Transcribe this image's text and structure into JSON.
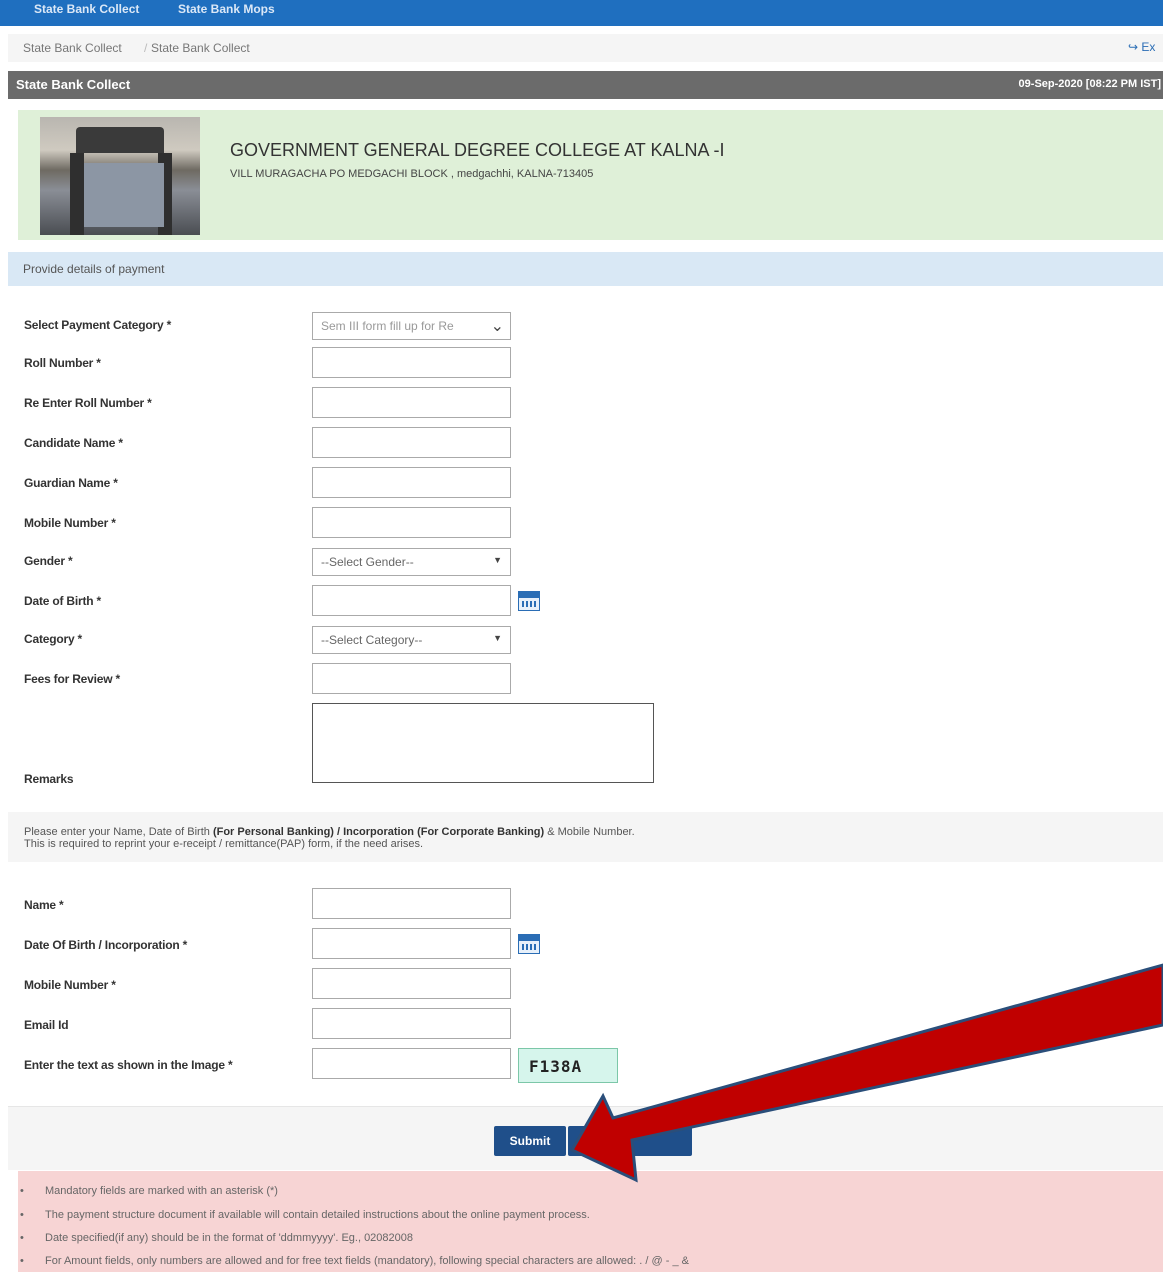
{
  "top_nav": {
    "items": [
      "State Bank Collect",
      "State Bank Mops"
    ]
  },
  "breadcrumb": {
    "items": [
      "State Bank Collect",
      "State Bank Collect"
    ],
    "separator": "/",
    "exit_label": "Ex"
  },
  "title_bar": {
    "title": "State Bank Collect",
    "datetime": "09-Sep-2020 [08:22 PM IST]"
  },
  "institution": {
    "name": "GOVERNMENT GENERAL DEGREE COLLEGE AT KALNA -I",
    "address": "VILL MURAGACHA PO MEDGACHI BLOCK , medgachhi, KALNA-713405"
  },
  "payment_section": {
    "heading": "Provide details of payment"
  },
  "form": {
    "payment_category": {
      "label": "Select Payment Category *",
      "value": "Sem III form fill up for Re"
    },
    "roll_number": {
      "label": "Roll Number *",
      "value": ""
    },
    "re_roll_number": {
      "label": "Re Enter Roll Number *",
      "value": ""
    },
    "candidate_name": {
      "label": "Candidate Name *",
      "value": ""
    },
    "guardian_name": {
      "label": "Guardian Name *",
      "value": ""
    },
    "mobile": {
      "label": "Mobile Number *",
      "value": ""
    },
    "gender": {
      "label": "Gender *",
      "value": "--Select Gender--"
    },
    "dob": {
      "label": "Date of Birth *",
      "value": ""
    },
    "category": {
      "label": "Category *",
      "value": "--Select Category--"
    },
    "fees": {
      "label": "Fees for Review *",
      "value": ""
    },
    "remarks": {
      "label": "Remarks",
      "value": ""
    }
  },
  "reprint_note": {
    "line1_pre": "Please enter your Name, Date of Birth ",
    "line1_bold": "(For Personal Banking) / Incorporation (For Corporate Banking)",
    "line1_post": " & Mobile Number.",
    "line2": "This is required to reprint your e-receipt / remittance(PAP) form, if the need arises."
  },
  "reprint_form": {
    "name": {
      "label": "Name *",
      "value": ""
    },
    "dob_inc": {
      "label": "Date Of Birth / Incorporation *",
      "value": ""
    },
    "mobile": {
      "label": "Mobile Number *",
      "value": ""
    },
    "email": {
      "label": "Email Id",
      "value": ""
    },
    "captcha": {
      "label": "Enter the text as shown in the Image *",
      "value": "",
      "image_text": "F138A"
    }
  },
  "buttons": {
    "submit": "Submit"
  },
  "notes": [
    "Mandatory fields are marked with an asterisk (*)",
    "The payment structure document if available will contain detailed instructions about the online payment process.",
    "Date specified(if any) should be in the format of 'ddmmyyyy'. Eg., 02082008",
    "For Amount fields, only numbers are allowed and for free text fields (mandatory), following special characters are allowed: . / @ - _ &"
  ],
  "colors": {
    "nav": "#1f6fbf",
    "title_bar": "#6b6b6b",
    "college_bg": "#dff0d8",
    "info_bg": "#d9e8f5",
    "notes_bg": "#f7d4d4",
    "button": "#1f4f8a",
    "annotation_arrow": "#c00000"
  }
}
